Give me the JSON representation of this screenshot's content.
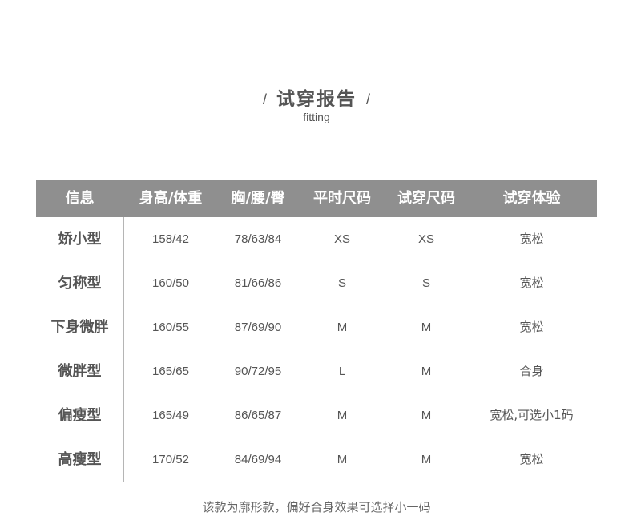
{
  "title": "试穿报告",
  "title_left_slash": "/",
  "title_right_slash": "/",
  "subtitle": "fitting",
  "table": {
    "headers": [
      "信息",
      "身高/体重",
      "胸/腰/臀",
      "平时尺码",
      "试穿尺码",
      "试穿体验"
    ],
    "rows": [
      [
        "娇小型",
        "158/42",
        "78/63/84",
        "XS",
        "XS",
        "宽松"
      ],
      [
        "匀称型",
        "160/50",
        "81/66/86",
        "S",
        "S",
        "宽松"
      ],
      [
        "下身微胖",
        "160/55",
        "87/69/90",
        "M",
        "M",
        "宽松"
      ],
      [
        "微胖型",
        "165/65",
        "90/72/95",
        "L",
        "M",
        "合身"
      ],
      [
        "偏瘦型",
        "165/49",
        "86/65/87",
        "M",
        "M",
        "宽松,可选小1码"
      ],
      [
        "高瘦型",
        "170/52",
        "84/69/94",
        "M",
        "M",
        "宽松"
      ]
    ]
  },
  "note": "该款为廓形款，偏好合身效果可选择小一码",
  "colors": {
    "header_bg": "#8f8f8f",
    "header_text": "#ffffff",
    "body_text": "#555555",
    "divider": "#b5b5b5"
  }
}
